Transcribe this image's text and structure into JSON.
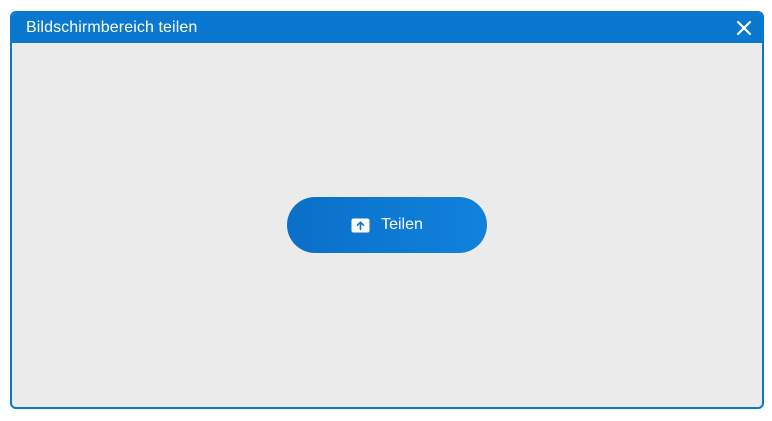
{
  "window": {
    "title": "Bildschirmbereich teilen"
  },
  "actions": {
    "share_label": "Teilen"
  },
  "icons": {
    "close": "close-icon",
    "share": "share-upload-icon"
  },
  "colors": {
    "accent": "#0a78d1",
    "content_background": "#ebebeb",
    "button_text": "#ffffff"
  }
}
